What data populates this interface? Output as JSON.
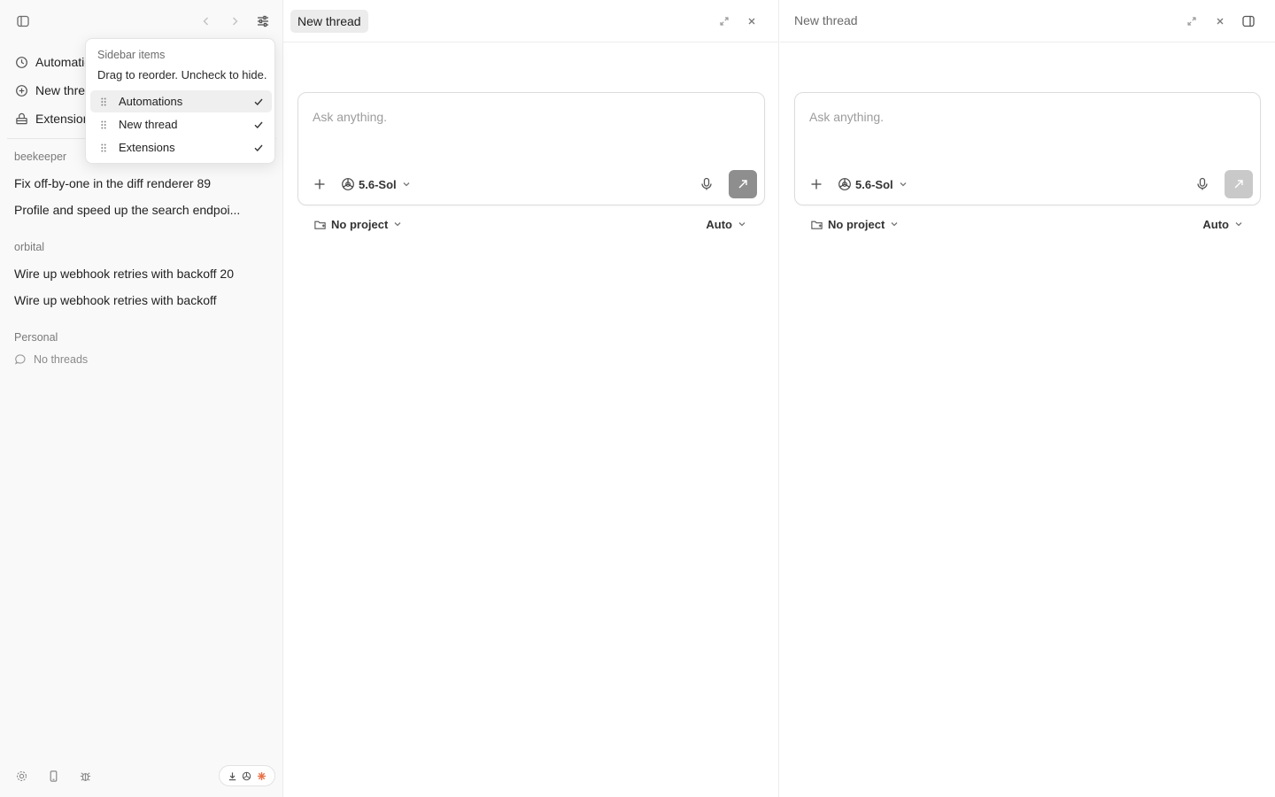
{
  "sidebar": {
    "nav": [
      {
        "label": "Automations",
        "icon": "clock-icon"
      },
      {
        "label": "New thread",
        "icon": "plus-circle-icon"
      },
      {
        "label": "Extensions",
        "icon": "extensions-icon"
      }
    ],
    "groups": [
      {
        "label": "beekeeper",
        "threads": [
          "Fix off-by-one in the diff renderer 89",
          "Profile and speed up the search endpoi..."
        ]
      },
      {
        "label": "orbital",
        "threads": [
          "Wire up webhook retries with backoff 20",
          "Wire up webhook retries with backoff"
        ]
      },
      {
        "label": "Personal",
        "empty_text": "No threads"
      }
    ]
  },
  "popover": {
    "title": "Sidebar items",
    "description": "Drag to reorder. Uncheck to hide.",
    "items": [
      {
        "label": "Automations",
        "checked": true
      },
      {
        "label": "New thread",
        "checked": true
      },
      {
        "label": "Extensions",
        "checked": true
      }
    ]
  },
  "panes": [
    {
      "title": "New thread",
      "placeholder": "Ask anything.",
      "model": "5.6-Sol",
      "project": "No project",
      "mode": "Auto"
    },
    {
      "title": "New thread",
      "placeholder": "Ask anything.",
      "model": "5.6-Sol",
      "project": "No project",
      "mode": "Auto"
    }
  ],
  "colors": {
    "send_active": "#8e8e8e",
    "send_inactive": "#c9c9c9",
    "pill_accent": "#e8734a"
  }
}
